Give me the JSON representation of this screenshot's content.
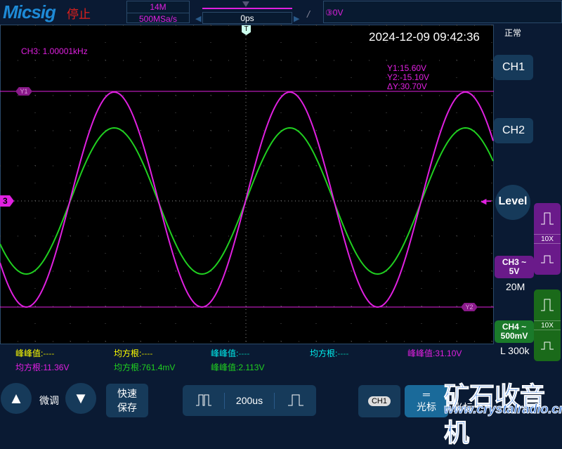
{
  "header": {
    "logo": "Micsig",
    "status": "停止",
    "memory_depth": "14M",
    "sample_rate": "500MSa/s",
    "time_position": "0ps",
    "trigger_level": "0V",
    "trigger_edge_icon": "rising-edge",
    "trigger_mode": "正常"
  },
  "screen": {
    "datetime": "2024-12-09 09:42:36",
    "frequency": "CH3: 1.00001kHz",
    "cursor": {
      "y1": "Y1:15.60V",
      "y2": "Y2:-15.10V",
      "dy": "ΔY:30.70V",
      "y1_label": "Y1",
      "y2_label": "Y2"
    },
    "trigger_marker": "T",
    "ch3_marker": "3"
  },
  "colors": {
    "ch3": "#e020e0",
    "ch4": "#20d020",
    "ch1": "#ffff00",
    "ch2": "#00e0e0"
  },
  "measurements": [
    {
      "label": "峰峰值:",
      "value": "----",
      "color": "#ffff00",
      "ch": "#c8c800"
    },
    {
      "label": "均方根:",
      "value": "----",
      "color": "#ffff00",
      "ch": "#c8c800"
    },
    {
      "label": "峰峰值:",
      "value": "----",
      "color": "#00e0e0",
      "ch": "#00a0a0"
    },
    {
      "label": "均方根:",
      "value": "----",
      "color": "#00e0e0",
      "ch": "#00a0a0"
    },
    {
      "label": "峰峰值:",
      "value": "31.10V",
      "color": "#e020e0",
      "ch": "#e020e0"
    },
    {
      "label": "均方根:",
      "value": "11.36V",
      "color": "#e020e0",
      "ch": "#e020e0"
    },
    {
      "label": "均方根:",
      "value": "761.4mV",
      "color": "#20d020",
      "ch": "#20d020"
    },
    {
      "label": "峰峰值:",
      "value": "2.113V",
      "color": "#20d020",
      "ch": "#20d020"
    }
  ],
  "right_panel": {
    "ch1": "CH1",
    "ch2": "CH2",
    "level": "Level",
    "ch3": {
      "name": "CH3 ~",
      "scale": "5V",
      "bandwidth": "20M",
      "probe": "10X"
    },
    "ch4": {
      "name": "CH4 ~",
      "scale": "500mV",
      "bandwidth": "L 300k",
      "probe": "10X"
    }
  },
  "bottom": {
    "fine_tune": "微调",
    "quick_save_1": "快速",
    "quick_save_2": "保存",
    "timebase": "200us",
    "ch_select": "CH1",
    "cursor": "光标",
    "cursor2": "光标"
  },
  "watermark": {
    "title": "矿石收音机",
    "url": "www.crystalradio.cn"
  }
}
